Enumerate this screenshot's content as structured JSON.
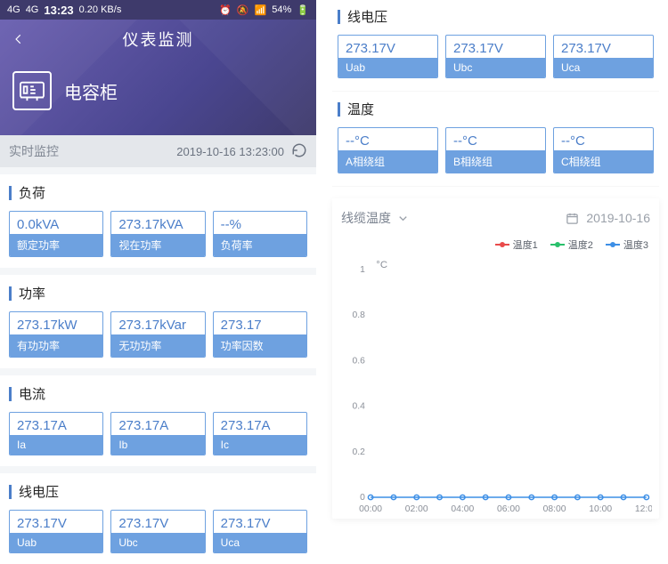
{
  "status": {
    "net1": "4G",
    "net2": "4G",
    "time": "13:23",
    "speed": "0.20 KB/s",
    "battery": "54%"
  },
  "header": {
    "title": "仪表监测",
    "device": "电容柜"
  },
  "subheader": {
    "label": "实时监控",
    "timestamp": "2019-10-16 13:23:00"
  },
  "left_sections": [
    {
      "title": "负荷",
      "cards": [
        {
          "value": "0.0kVA",
          "label": "额定功率"
        },
        {
          "value": "273.17kVA",
          "label": "视在功率"
        },
        {
          "value": "--%",
          "label": "负荷率"
        }
      ]
    },
    {
      "title": "功率",
      "cards": [
        {
          "value": "273.17kW",
          "label": "有功功率"
        },
        {
          "value": "273.17kVar",
          "label": "无功功率"
        },
        {
          "value": "273.17",
          "label": "功率因数"
        }
      ]
    },
    {
      "title": "电流",
      "cards": [
        {
          "value": "273.17A",
          "label": "Ia"
        },
        {
          "value": "273.17A",
          "label": "Ib"
        },
        {
          "value": "273.17A",
          "label": "Ic"
        }
      ]
    },
    {
      "title": "线电压",
      "cards": [
        {
          "value": "273.17V",
          "label": "Uab"
        },
        {
          "value": "273.17V",
          "label": "Ubc"
        },
        {
          "value": "273.17V",
          "label": "Uca"
        }
      ]
    }
  ],
  "right_sections": [
    {
      "title": "线电压",
      "cards": [
        {
          "value": "273.17V",
          "label": "Uab"
        },
        {
          "value": "273.17V",
          "label": "Ubc"
        },
        {
          "value": "273.17V",
          "label": "Uca"
        }
      ]
    },
    {
      "title": "温度",
      "cards": [
        {
          "value": "--°C",
          "label": "A相绕组"
        },
        {
          "value": "--°C",
          "label": "B相绕组"
        },
        {
          "value": "--°C",
          "label": "C相绕组"
        }
      ]
    }
  ],
  "chart_header": {
    "selector": "线缆温度",
    "date": "2019-10-16"
  },
  "legend": [
    "温度1",
    "温度2",
    "温度3"
  ],
  "legend_colors": [
    "#e94b4b",
    "#29c06b",
    "#3d8fe6"
  ],
  "chart_data": {
    "type": "line",
    "title": "",
    "ylabel": "°C",
    "xlabel": "",
    "ylim": [
      0,
      1
    ],
    "yticks": [
      0,
      0.2,
      0.4,
      0.6,
      0.8,
      1
    ],
    "x": [
      "00:00",
      "02:00",
      "04:00",
      "06:00",
      "08:00",
      "10:00",
      "12:00"
    ],
    "series": [
      {
        "name": "温度1",
        "values": [
          null,
          null,
          null,
          null,
          null,
          null,
          null
        ]
      },
      {
        "name": "温度2",
        "values": [
          null,
          null,
          null,
          null,
          null,
          null,
          null
        ]
      },
      {
        "name": "温度3",
        "values": [
          0,
          0,
          0,
          0,
          0,
          0,
          0
        ]
      }
    ]
  }
}
